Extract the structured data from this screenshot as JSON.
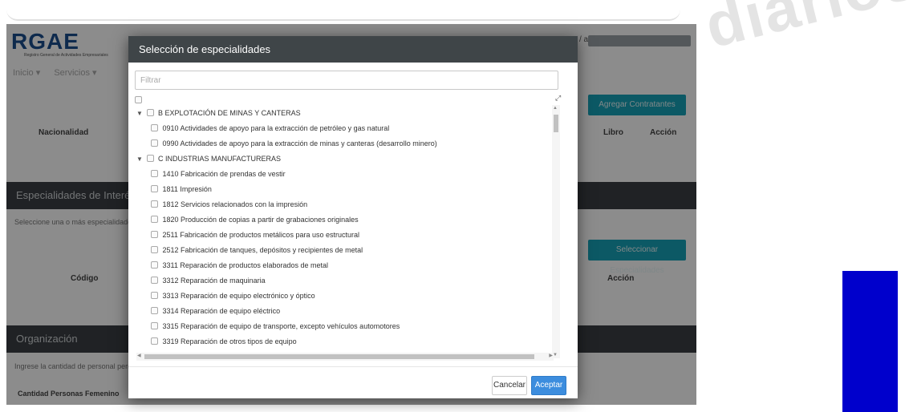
{
  "background": {
    "logo_text": "RGAE",
    "logo_subtitle": "Registro General de Actividades Empresariales",
    "nav_items": [
      "Inicio ▾",
      "Servicios ▾"
    ],
    "user_prefix": "/ at",
    "add_buttons": [
      "Agregar Contratantes",
      "Seleccionar Especialidades"
    ],
    "table1_headers": [
      "Nacionalidad",
      "Libro",
      "Acción"
    ],
    "section1_title": "Especialidades de Interés",
    "section1_help": "Seleccione una o más especialidades",
    "table2_headers": [
      "Código",
      "Acción"
    ],
    "section2_title": "Organización",
    "section2_help": "Ingrese la cantidad de personal permanente",
    "field_label": "Cantidad Personas Femenino",
    "watermark": "diarios"
  },
  "modal": {
    "title": "Selección de especialidades",
    "filter_placeholder": "Filtrar",
    "tree": [
      {
        "type": "group",
        "label": "B EXPLOTACIÓN DE MINAS Y CANTERAS"
      },
      {
        "type": "item",
        "label": "0910 Actividades de apoyo para la extracción de petróleo y gas natural"
      },
      {
        "type": "item",
        "label": "0990 Actividades de apoyo para la extracción de minas y canteras (desarrollo minero)"
      },
      {
        "type": "group",
        "label": "C INDUSTRIAS MANUFACTURERAS"
      },
      {
        "type": "item",
        "label": "1410 Fabricación de prendas de vestir"
      },
      {
        "type": "item",
        "label": "1811 Impresión"
      },
      {
        "type": "item",
        "label": "1812 Servicios relacionados con la impresión"
      },
      {
        "type": "item",
        "label": "1820 Producción de copias a partir de grabaciones originales"
      },
      {
        "type": "item",
        "label": "2511 Fabricación de productos metálicos para uso estructural"
      },
      {
        "type": "item",
        "label": "2512 Fabricación de tanques, depósitos y recipientes de metal"
      },
      {
        "type": "item",
        "label": "3311 Reparación de productos elaborados de metal"
      },
      {
        "type": "item",
        "label": "3312 Reparación de maquinaria"
      },
      {
        "type": "item",
        "label": "3313 Reparación de equipo electrónico y óptico"
      },
      {
        "type": "item",
        "label": "3314 Reparación de equipo eléctrico"
      },
      {
        "type": "item",
        "label": "3315 Reparación de equipo de transporte, excepto vehículos automotores"
      },
      {
        "type": "item",
        "label": "3319 Reparación de otros tipos de equipo"
      }
    ],
    "cancel_label": "Cancelar",
    "accept_label": "Aceptar"
  },
  "colors": {
    "modal_header": "#3f4548",
    "accept_button": "#3c8dde",
    "accent_teal": "#17a2b8",
    "blue_block": "#0000cc"
  }
}
